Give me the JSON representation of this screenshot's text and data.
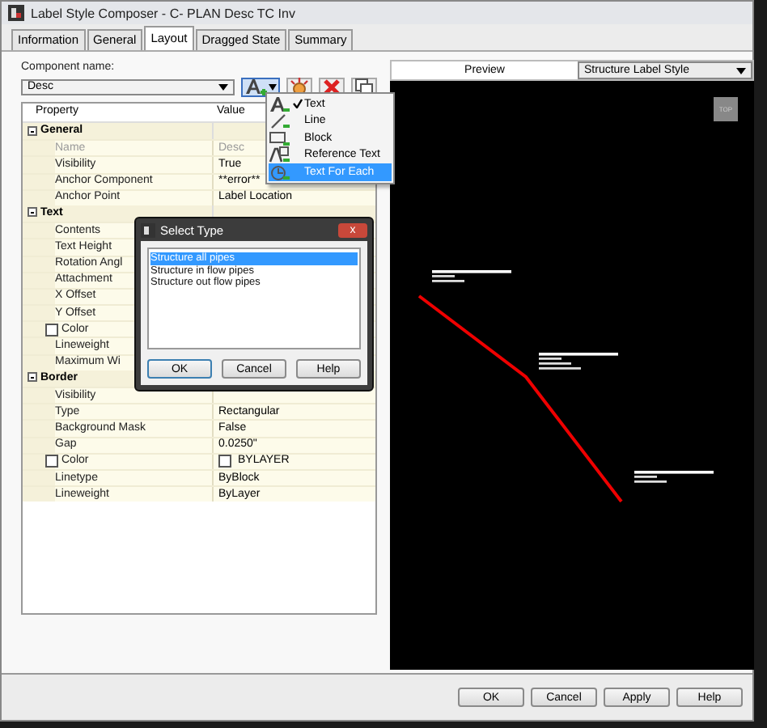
{
  "window": {
    "title": "Label Style Composer - C- PLAN Desc TC Inv"
  },
  "tabs": [
    {
      "label": "Information",
      "selected": false
    },
    {
      "label": "General",
      "selected": false
    },
    {
      "label": "Layout",
      "selected": true
    },
    {
      "label": "Dragged State",
      "selected": false
    },
    {
      "label": "Summary",
      "selected": false
    }
  ],
  "component": {
    "label": "Component name:",
    "value": "Desc"
  },
  "property_grid": {
    "columns": [
      "Property",
      "Value"
    ],
    "groups": [
      {
        "name": "General",
        "expanded": true,
        "rows": [
          {
            "kind": "text",
            "name": "Name",
            "value": "Desc",
            "disabled": true
          },
          {
            "kind": "text",
            "name": "Visibility",
            "value": "True",
            "disabled": false
          },
          {
            "kind": "text",
            "name": "Anchor Component",
            "value": "**error**",
            "disabled": false
          },
          {
            "kind": "text",
            "name": "Anchor Point",
            "value": "Label Location",
            "disabled": false
          }
        ]
      },
      {
        "name": "Text",
        "expanded": true,
        "rows": [
          {
            "kind": "text",
            "name": "Contents",
            "disabled": false
          },
          {
            "kind": "text",
            "name": "Text Height",
            "disabled": false
          },
          {
            "kind": "text",
            "name": "Rotation Angl",
            "disabled": false
          },
          {
            "kind": "text",
            "name": "Attachment",
            "disabled": false
          },
          {
            "kind": "text",
            "name": "X Offset",
            "disabled": false
          },
          {
            "kind": "text",
            "name": "Y Offset",
            "disabled": false
          },
          {
            "kind": "color",
            "name": "Color",
            "checked": false,
            "disabled": false
          },
          {
            "kind": "text",
            "name": "Lineweight",
            "disabled": false
          },
          {
            "kind": "text",
            "name": "Maximum Wi",
            "disabled": false
          }
        ]
      },
      {
        "name": "Border",
        "expanded": true,
        "rows": [
          {
            "kind": "text",
            "name": "Visibility",
            "disabled": false
          },
          {
            "kind": "text",
            "name": "Type",
            "value": "Rectangular",
            "disabled": false
          },
          {
            "kind": "text",
            "name": "Background Mask",
            "value": "False",
            "disabled": false
          },
          {
            "kind": "text",
            "name": "Gap",
            "value": "0.0250\"",
            "disabled": false
          },
          {
            "kind": "color",
            "name": "Color",
            "checked": false,
            "value": "BYLAYER",
            "disabled": false
          },
          {
            "kind": "text",
            "name": "Linetype",
            "value": "ByBlock",
            "disabled": false
          },
          {
            "kind": "text",
            "name": "Lineweight",
            "value": "ByLayer",
            "disabled": false
          }
        ]
      }
    ]
  },
  "component_menu": {
    "items": [
      {
        "label": "Text",
        "checked": true,
        "selected": false
      },
      {
        "label": "Line",
        "checked": false,
        "selected": false
      },
      {
        "label": "Block",
        "checked": false,
        "selected": false
      },
      {
        "label": "Reference Text",
        "checked": false,
        "selected": false
      },
      {
        "label": "Text For Each",
        "checked": false,
        "selected": true
      }
    ]
  },
  "preview": {
    "label": "Preview",
    "style": "Structure Label Style",
    "view_button": "TOP"
  },
  "select_type_dialog": {
    "title": "Select Type",
    "close": "x",
    "items": [
      {
        "label": "Structure all pipes",
        "selected": true
      },
      {
        "label": "Structure in flow pipes",
        "selected": false
      },
      {
        "label": "Structure out flow pipes",
        "selected": false
      }
    ],
    "buttons": [
      "OK",
      "Cancel",
      "Help"
    ]
  },
  "buttons": [
    "OK",
    "Cancel",
    "Apply",
    "Help"
  ]
}
